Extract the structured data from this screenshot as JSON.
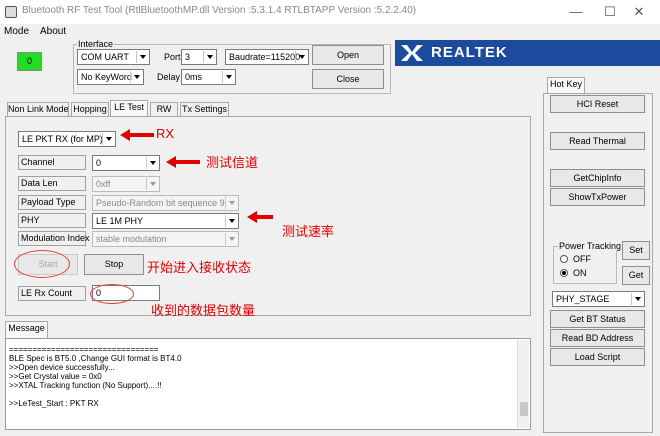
{
  "window": {
    "title": "Bluetooth RF Test Tool (RtlBluetoothMP.dll Version :5.3.1.4   RTLBTAPP Version :5.2.2.40)",
    "minimize": "—",
    "maximize": "☐",
    "close": "✕"
  },
  "menu": [
    "Mode",
    "About"
  ],
  "status_indicator": "0",
  "interface": {
    "group_label": "Interface",
    "type": "COM UART",
    "port_label": "Port",
    "port": "3",
    "baudrate": "Baudrate=115200",
    "keyword": "No KeyWord",
    "delay_label": "Delay",
    "delay": "0ms",
    "open_label": "Open",
    "close_label": "Close"
  },
  "logo": {
    "text": "REALTEK"
  },
  "tabs": [
    "Non Link Mode",
    "Hopping",
    "LE Test",
    "RW",
    "Tx Settings"
  ],
  "le_test": {
    "mode_select": "LE PKT RX (for MP)",
    "rows": [
      {
        "label": "Channel",
        "value": "0"
      },
      {
        "label": "Data Len",
        "value": "0xff"
      },
      {
        "label": "Payload Type",
        "value": "Pseudo-Random bit sequence 9"
      },
      {
        "label": "PHY",
        "value": "LE 1M PHY"
      },
      {
        "label": "Modulation Index",
        "value": "stable modulation"
      }
    ],
    "start_label": "Start",
    "stop_label": "Stop",
    "rx_count_label": "LE Rx Count",
    "rx_count_value": "0"
  },
  "annotations": {
    "rx": "RX",
    "channel": "测试信道",
    "rate": "测试速率",
    "start": "开始进入接收状态",
    "count": "收到的数据包数量"
  },
  "message": {
    "tab_label": "Message",
    "lines": [
      "================================",
      "BLE Spec is BT5.0 ,Change GUI format is BT4.0",
      ">>Open device successfully...",
      ">>Get Crystal value = 0x0",
      ">>XTAL Tracking function (No Support)....!!",
      "",
      ">>LeTest_Start : PKT RX"
    ]
  },
  "hotkey": {
    "tab_label": "Hot Key",
    "hci_reset": "HCI Reset",
    "read_thermal": "Read Thermal",
    "get_chip_info": "GetChipInfo",
    "show_tx_power": "ShowTxPower",
    "power_tracking_label": "Power Tracking",
    "off_label": "OFF",
    "on_label": "ON",
    "set_label": "Set",
    "get_label": "Get",
    "phy_stage": "PHY_STAGE",
    "get_bt_status": "Get BT Status",
    "read_bd_address": "Read BD Address",
    "load_script": "Load Script"
  },
  "colors": {
    "status_green": "#22dd22",
    "logo_blue": "#1c4a9c",
    "annotation_red": "#e00000"
  }
}
